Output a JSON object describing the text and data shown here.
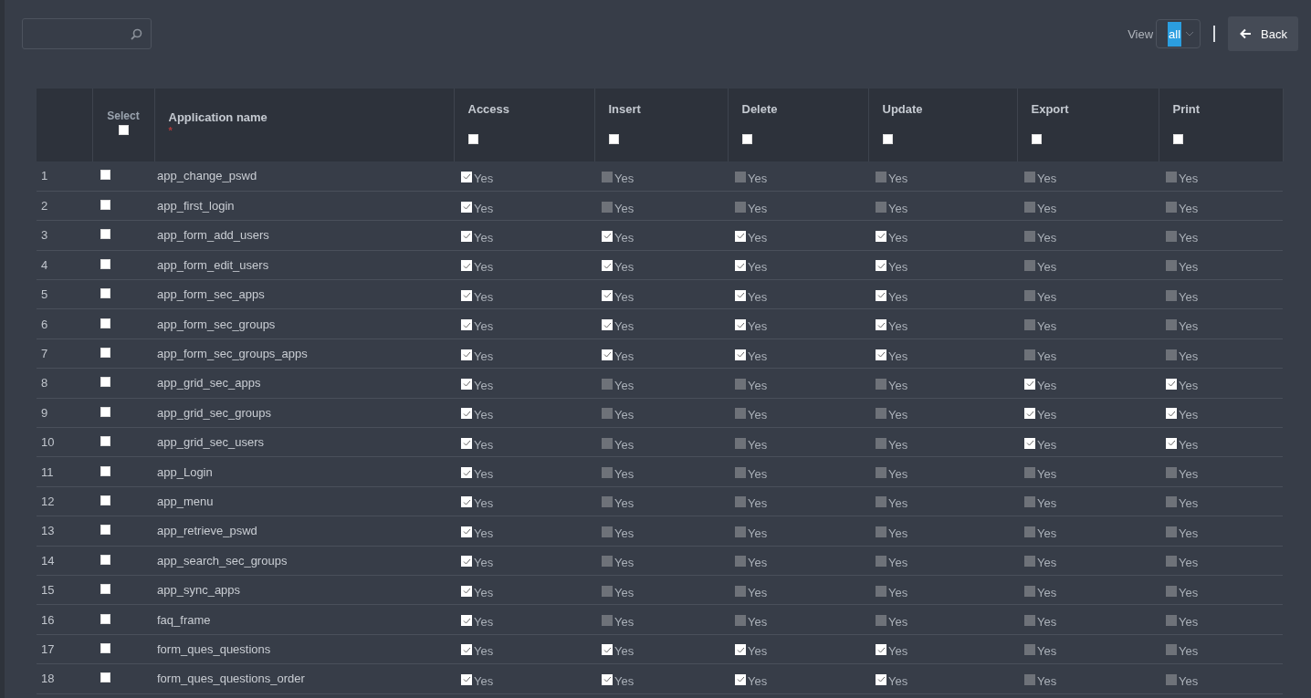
{
  "view": {
    "label": "View",
    "value": "all"
  },
  "back_button": {
    "label": "Back"
  },
  "table": {
    "columns": [
      {
        "kind": "number"
      },
      {
        "kind": "select",
        "label": "Select",
        "checked": false
      },
      {
        "kind": "name",
        "label": "Application name",
        "required_mark": "*"
      },
      {
        "kind": "perm",
        "label": "Access",
        "checked": false
      },
      {
        "kind": "perm",
        "label": "Insert",
        "checked": false
      },
      {
        "kind": "perm",
        "label": "Delete",
        "checked": false
      },
      {
        "kind": "perm",
        "label": "Update",
        "checked": false
      },
      {
        "kind": "perm",
        "label": "Export",
        "checked": false
      },
      {
        "kind": "perm",
        "label": "Print",
        "checked": false
      }
    ],
    "rows": [
      {
        "number": "1",
        "selected": false,
        "name": "app_change_pswd",
        "perms": [
          {
            "label": "Yes",
            "checked": true
          },
          {
            "label": "Yes",
            "checked": false
          },
          {
            "label": "Yes",
            "checked": false
          },
          {
            "label": "Yes",
            "checked": false
          },
          {
            "label": "Yes",
            "checked": false
          },
          {
            "label": "Yes",
            "checked": false
          }
        ]
      },
      {
        "number": "2",
        "selected": false,
        "name": "app_first_login",
        "perms": [
          {
            "label": "Yes",
            "checked": true
          },
          {
            "label": "Yes",
            "checked": false
          },
          {
            "label": "Yes",
            "checked": false
          },
          {
            "label": "Yes",
            "checked": false
          },
          {
            "label": "Yes",
            "checked": false
          },
          {
            "label": "Yes",
            "checked": false
          }
        ]
      },
      {
        "number": "3",
        "selected": false,
        "name": "app_form_add_users",
        "perms": [
          {
            "label": "Yes",
            "checked": true
          },
          {
            "label": "Yes",
            "checked": true
          },
          {
            "label": "Yes",
            "checked": true
          },
          {
            "label": "Yes",
            "checked": true
          },
          {
            "label": "Yes",
            "checked": false
          },
          {
            "label": "Yes",
            "checked": false
          }
        ]
      },
      {
        "number": "4",
        "selected": false,
        "name": "app_form_edit_users",
        "perms": [
          {
            "label": "Yes",
            "checked": true
          },
          {
            "label": "Yes",
            "checked": true
          },
          {
            "label": "Yes",
            "checked": true
          },
          {
            "label": "Yes",
            "checked": true
          },
          {
            "label": "Yes",
            "checked": false
          },
          {
            "label": "Yes",
            "checked": false
          }
        ]
      },
      {
        "number": "5",
        "selected": false,
        "name": "app_form_sec_apps",
        "perms": [
          {
            "label": "Yes",
            "checked": true
          },
          {
            "label": "Yes",
            "checked": true
          },
          {
            "label": "Yes",
            "checked": true
          },
          {
            "label": "Yes",
            "checked": true
          },
          {
            "label": "Yes",
            "checked": false
          },
          {
            "label": "Yes",
            "checked": false
          }
        ]
      },
      {
        "number": "6",
        "selected": false,
        "name": "app_form_sec_groups",
        "perms": [
          {
            "label": "Yes",
            "checked": true
          },
          {
            "label": "Yes",
            "checked": true
          },
          {
            "label": "Yes",
            "checked": true
          },
          {
            "label": "Yes",
            "checked": true
          },
          {
            "label": "Yes",
            "checked": false
          },
          {
            "label": "Yes",
            "checked": false
          }
        ]
      },
      {
        "number": "7",
        "selected": false,
        "name": "app_form_sec_groups_apps",
        "perms": [
          {
            "label": "Yes",
            "checked": true
          },
          {
            "label": "Yes",
            "checked": true
          },
          {
            "label": "Yes",
            "checked": true
          },
          {
            "label": "Yes",
            "checked": true
          },
          {
            "label": "Yes",
            "checked": false
          },
          {
            "label": "Yes",
            "checked": false
          }
        ]
      },
      {
        "number": "8",
        "selected": false,
        "name": "app_grid_sec_apps",
        "perms": [
          {
            "label": "Yes",
            "checked": true
          },
          {
            "label": "Yes",
            "checked": false
          },
          {
            "label": "Yes",
            "checked": false
          },
          {
            "label": "Yes",
            "checked": false
          },
          {
            "label": "Yes",
            "checked": true
          },
          {
            "label": "Yes",
            "checked": true
          }
        ]
      },
      {
        "number": "9",
        "selected": false,
        "name": "app_grid_sec_groups",
        "perms": [
          {
            "label": "Yes",
            "checked": true
          },
          {
            "label": "Yes",
            "checked": false
          },
          {
            "label": "Yes",
            "checked": false
          },
          {
            "label": "Yes",
            "checked": false
          },
          {
            "label": "Yes",
            "checked": true
          },
          {
            "label": "Yes",
            "checked": true
          }
        ]
      },
      {
        "number": "10",
        "selected": false,
        "name": "app_grid_sec_users",
        "perms": [
          {
            "label": "Yes",
            "checked": true
          },
          {
            "label": "Yes",
            "checked": false
          },
          {
            "label": "Yes",
            "checked": false
          },
          {
            "label": "Yes",
            "checked": false
          },
          {
            "label": "Yes",
            "checked": true
          },
          {
            "label": "Yes",
            "checked": true
          }
        ]
      },
      {
        "number": "11",
        "selected": false,
        "name": "app_Login",
        "perms": [
          {
            "label": "Yes",
            "checked": true
          },
          {
            "label": "Yes",
            "checked": false
          },
          {
            "label": "Yes",
            "checked": false
          },
          {
            "label": "Yes",
            "checked": false
          },
          {
            "label": "Yes",
            "checked": false
          },
          {
            "label": "Yes",
            "checked": false
          }
        ]
      },
      {
        "number": "12",
        "selected": false,
        "name": "app_menu",
        "perms": [
          {
            "label": "Yes",
            "checked": true
          },
          {
            "label": "Yes",
            "checked": false
          },
          {
            "label": "Yes",
            "checked": false
          },
          {
            "label": "Yes",
            "checked": false
          },
          {
            "label": "Yes",
            "checked": false
          },
          {
            "label": "Yes",
            "checked": false
          }
        ]
      },
      {
        "number": "13",
        "selected": false,
        "name": "app_retrieve_pswd",
        "perms": [
          {
            "label": "Yes",
            "checked": true
          },
          {
            "label": "Yes",
            "checked": false
          },
          {
            "label": "Yes",
            "checked": false
          },
          {
            "label": "Yes",
            "checked": false
          },
          {
            "label": "Yes",
            "checked": false
          },
          {
            "label": "Yes",
            "checked": false
          }
        ]
      },
      {
        "number": "14",
        "selected": false,
        "name": "app_search_sec_groups",
        "perms": [
          {
            "label": "Yes",
            "checked": true
          },
          {
            "label": "Yes",
            "checked": false
          },
          {
            "label": "Yes",
            "checked": false
          },
          {
            "label": "Yes",
            "checked": false
          },
          {
            "label": "Yes",
            "checked": false
          },
          {
            "label": "Yes",
            "checked": false
          }
        ]
      },
      {
        "number": "15",
        "selected": false,
        "name": "app_sync_apps",
        "perms": [
          {
            "label": "Yes",
            "checked": true
          },
          {
            "label": "Yes",
            "checked": false
          },
          {
            "label": "Yes",
            "checked": false
          },
          {
            "label": "Yes",
            "checked": false
          },
          {
            "label": "Yes",
            "checked": false
          },
          {
            "label": "Yes",
            "checked": false
          }
        ]
      },
      {
        "number": "16",
        "selected": false,
        "name": "faq_frame",
        "perms": [
          {
            "label": "Yes",
            "checked": true
          },
          {
            "label": "Yes",
            "checked": false
          },
          {
            "label": "Yes",
            "checked": false
          },
          {
            "label": "Yes",
            "checked": false
          },
          {
            "label": "Yes",
            "checked": false
          },
          {
            "label": "Yes",
            "checked": false
          }
        ]
      },
      {
        "number": "17",
        "selected": false,
        "name": "form_ques_questions",
        "perms": [
          {
            "label": "Yes",
            "checked": true
          },
          {
            "label": "Yes",
            "checked": true
          },
          {
            "label": "Yes",
            "checked": true
          },
          {
            "label": "Yes",
            "checked": true
          },
          {
            "label": "Yes",
            "checked": false
          },
          {
            "label": "Yes",
            "checked": false
          }
        ]
      },
      {
        "number": "18",
        "selected": false,
        "name": "form_ques_questions_order",
        "perms": [
          {
            "label": "Yes",
            "checked": true
          },
          {
            "label": "Yes",
            "checked": true
          },
          {
            "label": "Yes",
            "checked": true
          },
          {
            "label": "Yes",
            "checked": true
          },
          {
            "label": "Yes",
            "checked": false
          },
          {
            "label": "Yes",
            "checked": false
          }
        ]
      }
    ]
  }
}
